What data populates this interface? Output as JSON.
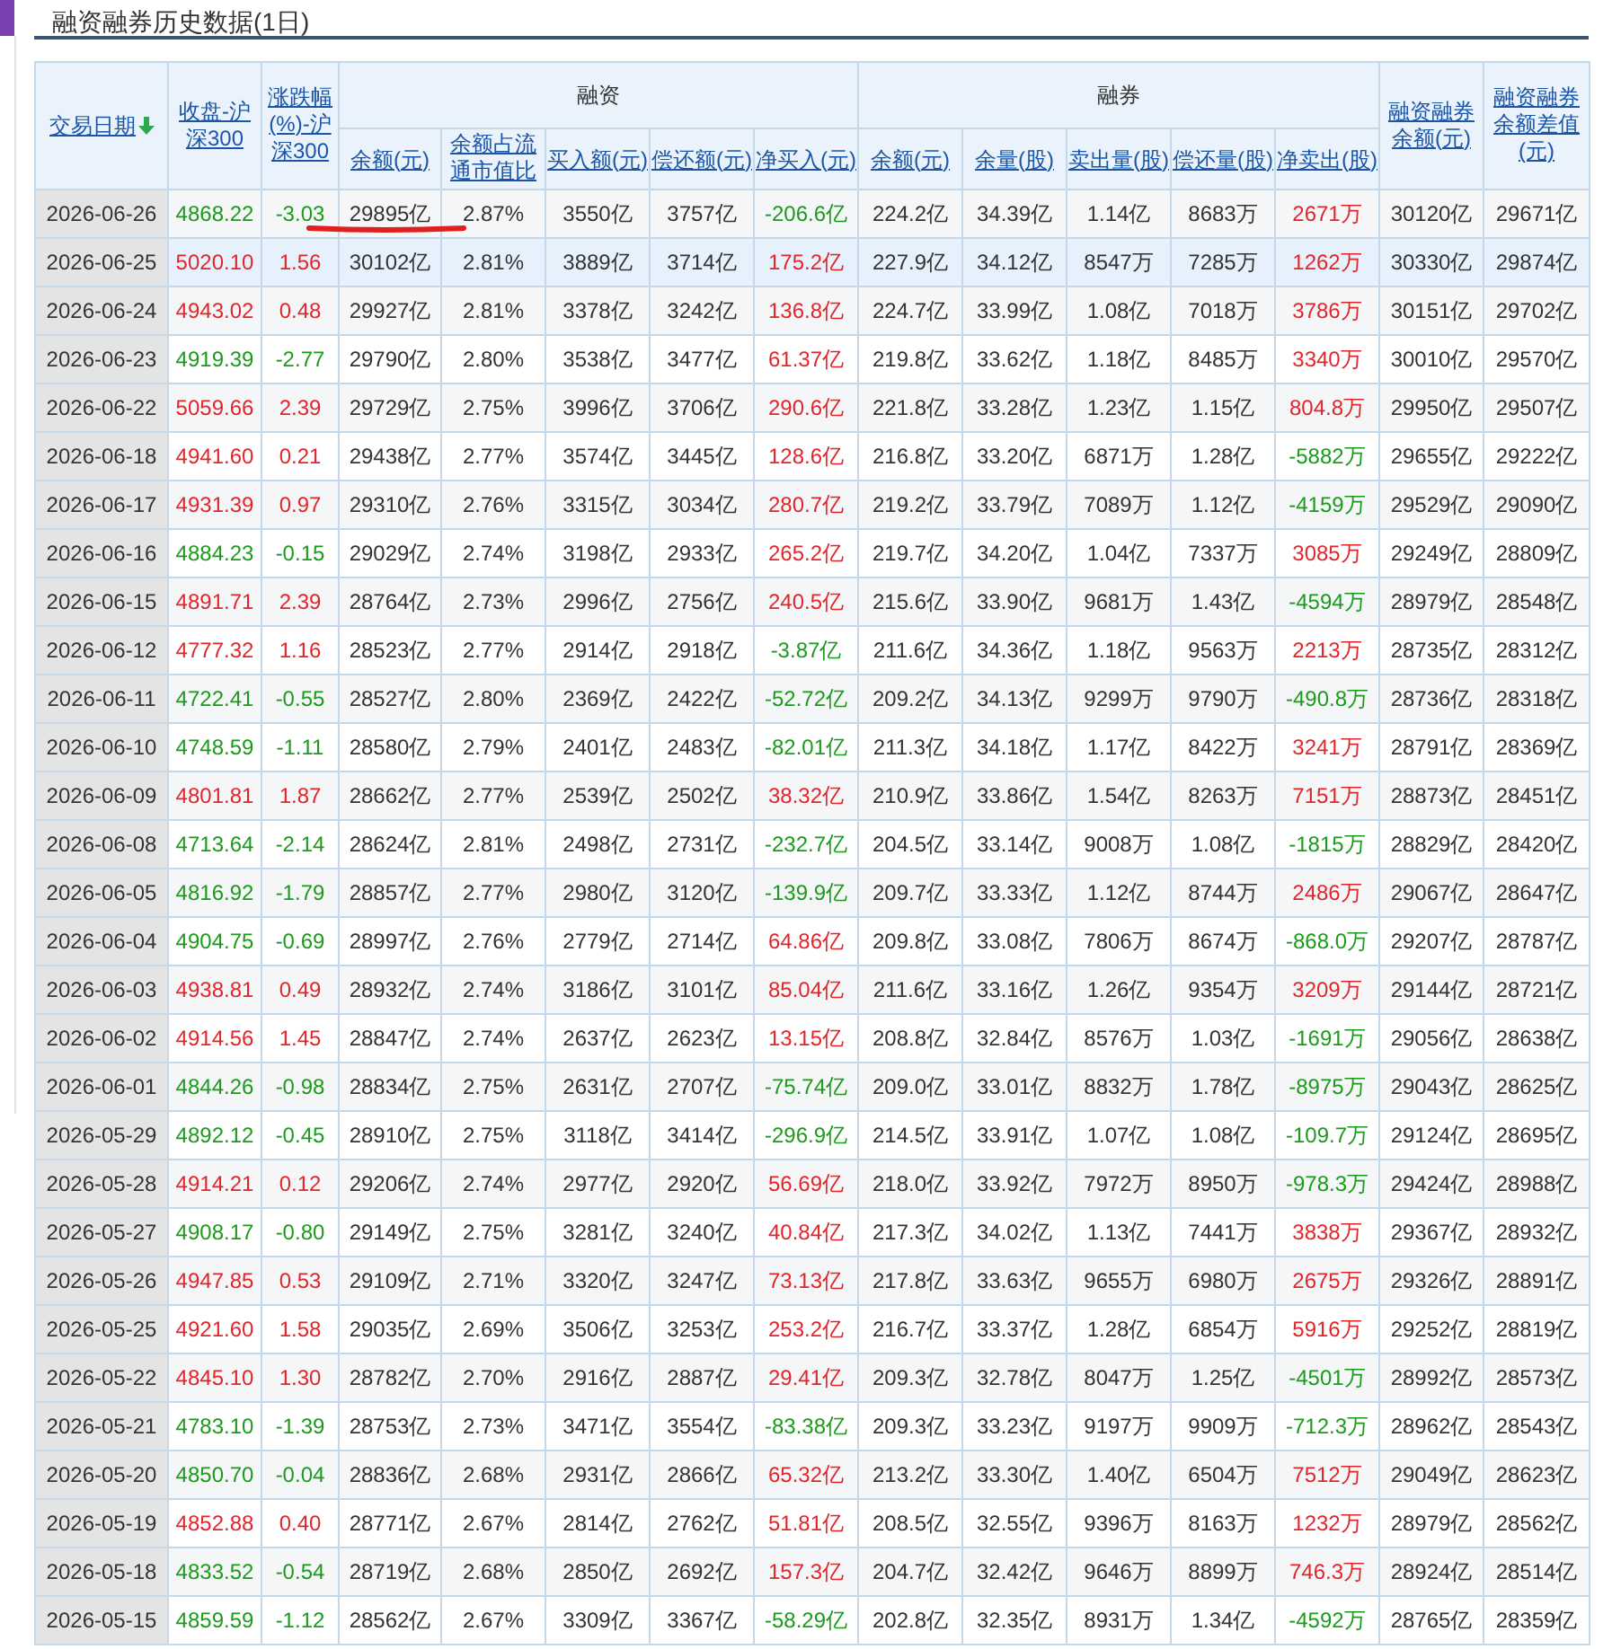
{
  "title": "融资融券历史数据(1日)",
  "columns": {
    "date": "交易日期",
    "close": "收盘-沪深300",
    "change": "涨跌幅(%)-沪深300",
    "financing": "融资",
    "securities": "融券",
    "total": "融资融券余额(元)",
    "diff": "融资融券余额差值(元)",
    "financing_sub": [
      "余额(元)",
      "余额占流通市值比",
      "买入额(元)",
      "偿还额(元)",
      "净买入(元)"
    ],
    "securities_sub": [
      "余额(元)",
      "余量(股)",
      "卖出量(股)",
      "偿还量(股)",
      "净卖出(股)"
    ]
  },
  "rows": [
    {
      "date": "2026-06-26",
      "selected": false,
      "rising": false,
      "buy_rising": false,
      "sell_rising": true,
      "cells": [
        "4868.22",
        "-3.03",
        "29895亿",
        "2.87%",
        "3550亿",
        "3757亿",
        "-206.6亿",
        "224.2亿",
        "34.39亿",
        "1.14亿",
        "8683万",
        "2671万",
        "30120亿",
        "29671亿"
      ]
    },
    {
      "date": "2026-06-25",
      "selected": true,
      "rising": true,
      "buy_rising": true,
      "sell_rising": true,
      "cells": [
        "5020.10",
        "1.56",
        "30102亿",
        "2.81%",
        "3889亿",
        "3714亿",
        "175.2亿",
        "227.9亿",
        "34.12亿",
        "8547万",
        "7285万",
        "1262万",
        "30330亿",
        "29874亿"
      ]
    },
    {
      "date": "2026-06-24",
      "selected": false,
      "rising": true,
      "buy_rising": true,
      "sell_rising": true,
      "cells": [
        "4943.02",
        "0.48",
        "29927亿",
        "2.81%",
        "3378亿",
        "3242亿",
        "136.8亿",
        "224.7亿",
        "33.99亿",
        "1.08亿",
        "7018万",
        "3786万",
        "30151亿",
        "29702亿"
      ]
    },
    {
      "date": "2026-06-23",
      "selected": false,
      "rising": false,
      "buy_rising": true,
      "sell_rising": true,
      "cells": [
        "4919.39",
        "-2.77",
        "29790亿",
        "2.80%",
        "3538亿",
        "3477亿",
        "61.37亿",
        "219.8亿",
        "33.62亿",
        "1.18亿",
        "8485万",
        "3340万",
        "30010亿",
        "29570亿"
      ]
    },
    {
      "date": "2026-06-22",
      "selected": false,
      "rising": true,
      "buy_rising": true,
      "sell_rising": true,
      "cells": [
        "5059.66",
        "2.39",
        "29729亿",
        "2.75%",
        "3996亿",
        "3706亿",
        "290.6亿",
        "221.8亿",
        "33.28亿",
        "1.23亿",
        "1.15亿",
        "804.8万",
        "29950亿",
        "29507亿"
      ]
    },
    {
      "date": "2026-06-18",
      "selected": false,
      "rising": true,
      "buy_rising": true,
      "sell_rising": false,
      "cells": [
        "4941.60",
        "0.21",
        "29438亿",
        "2.77%",
        "3574亿",
        "3445亿",
        "128.6亿",
        "216.8亿",
        "33.20亿",
        "6871万",
        "1.28亿",
        "-5882万",
        "29655亿",
        "29222亿"
      ]
    },
    {
      "date": "2026-06-17",
      "selected": false,
      "rising": true,
      "buy_rising": true,
      "sell_rising": false,
      "cells": [
        "4931.39",
        "0.97",
        "29310亿",
        "2.76%",
        "3315亿",
        "3034亿",
        "280.7亿",
        "219.2亿",
        "33.79亿",
        "7089万",
        "1.12亿",
        "-4159万",
        "29529亿",
        "29090亿"
      ]
    },
    {
      "date": "2026-06-16",
      "selected": false,
      "rising": false,
      "buy_rising": true,
      "sell_rising": true,
      "cells": [
        "4884.23",
        "-0.15",
        "29029亿",
        "2.74%",
        "3198亿",
        "2933亿",
        "265.2亿",
        "219.7亿",
        "34.20亿",
        "1.04亿",
        "7337万",
        "3085万",
        "29249亿",
        "28809亿"
      ]
    },
    {
      "date": "2026-06-15",
      "selected": false,
      "rising": true,
      "buy_rising": true,
      "sell_rising": false,
      "cells": [
        "4891.71",
        "2.39",
        "28764亿",
        "2.73%",
        "2996亿",
        "2756亿",
        "240.5亿",
        "215.6亿",
        "33.90亿",
        "9681万",
        "1.43亿",
        "-4594万",
        "28979亿",
        "28548亿"
      ]
    },
    {
      "date": "2026-06-12",
      "selected": false,
      "rising": true,
      "buy_rising": false,
      "sell_rising": true,
      "cells": [
        "4777.32",
        "1.16",
        "28523亿",
        "2.77%",
        "2914亿",
        "2918亿",
        "-3.87亿",
        "211.6亿",
        "34.36亿",
        "1.18亿",
        "9563万",
        "2213万",
        "28735亿",
        "28312亿"
      ]
    },
    {
      "date": "2026-06-11",
      "selected": false,
      "rising": false,
      "buy_rising": false,
      "sell_rising": false,
      "cells": [
        "4722.41",
        "-0.55",
        "28527亿",
        "2.80%",
        "2369亿",
        "2422亿",
        "-52.72亿",
        "209.2亿",
        "34.13亿",
        "9299万",
        "9790万",
        "-490.8万",
        "28736亿",
        "28318亿"
      ]
    },
    {
      "date": "2026-06-10",
      "selected": false,
      "rising": false,
      "buy_rising": false,
      "sell_rising": true,
      "cells": [
        "4748.59",
        "-1.11",
        "28580亿",
        "2.79%",
        "2401亿",
        "2483亿",
        "-82.01亿",
        "211.3亿",
        "34.18亿",
        "1.17亿",
        "8422万",
        "3241万",
        "28791亿",
        "28369亿"
      ]
    },
    {
      "date": "2026-06-09",
      "selected": false,
      "rising": true,
      "buy_rising": true,
      "sell_rising": true,
      "cells": [
        "4801.81",
        "1.87",
        "28662亿",
        "2.77%",
        "2539亿",
        "2502亿",
        "38.32亿",
        "210.9亿",
        "33.86亿",
        "1.54亿",
        "8263万",
        "7151万",
        "28873亿",
        "28451亿"
      ]
    },
    {
      "date": "2026-06-08",
      "selected": false,
      "rising": false,
      "buy_rising": false,
      "sell_rising": false,
      "cells": [
        "4713.64",
        "-2.14",
        "28624亿",
        "2.81%",
        "2498亿",
        "2731亿",
        "-232.7亿",
        "204.5亿",
        "33.14亿",
        "9008万",
        "1.08亿",
        "-1815万",
        "28829亿",
        "28420亿"
      ]
    },
    {
      "date": "2026-06-05",
      "selected": false,
      "rising": false,
      "buy_rising": false,
      "sell_rising": true,
      "cells": [
        "4816.92",
        "-1.79",
        "28857亿",
        "2.77%",
        "2980亿",
        "3120亿",
        "-139.9亿",
        "209.7亿",
        "33.33亿",
        "1.12亿",
        "8744万",
        "2486万",
        "29067亿",
        "28647亿"
      ]
    },
    {
      "date": "2026-06-04",
      "selected": false,
      "rising": false,
      "buy_rising": true,
      "sell_rising": false,
      "cells": [
        "4904.75",
        "-0.69",
        "28997亿",
        "2.76%",
        "2779亿",
        "2714亿",
        "64.86亿",
        "209.8亿",
        "33.08亿",
        "7806万",
        "8674万",
        "-868.0万",
        "29207亿",
        "28787亿"
      ]
    },
    {
      "date": "2026-06-03",
      "selected": false,
      "rising": true,
      "buy_rising": true,
      "sell_rising": true,
      "cells": [
        "4938.81",
        "0.49",
        "28932亿",
        "2.74%",
        "3186亿",
        "3101亿",
        "85.04亿",
        "211.6亿",
        "33.16亿",
        "1.26亿",
        "9354万",
        "3209万",
        "29144亿",
        "28721亿"
      ]
    },
    {
      "date": "2026-06-02",
      "selected": false,
      "rising": true,
      "buy_rising": true,
      "sell_rising": false,
      "cells": [
        "4914.56",
        "1.45",
        "28847亿",
        "2.74%",
        "2637亿",
        "2623亿",
        "13.15亿",
        "208.8亿",
        "32.84亿",
        "8576万",
        "1.03亿",
        "-1691万",
        "29056亿",
        "28638亿"
      ]
    },
    {
      "date": "2026-06-01",
      "selected": false,
      "rising": false,
      "buy_rising": false,
      "sell_rising": false,
      "cells": [
        "4844.26",
        "-0.98",
        "28834亿",
        "2.75%",
        "2631亿",
        "2707亿",
        "-75.74亿",
        "209.0亿",
        "33.01亿",
        "8832万",
        "1.78亿",
        "-8975万",
        "29043亿",
        "28625亿"
      ]
    },
    {
      "date": "2026-05-29",
      "selected": false,
      "rising": false,
      "buy_rising": false,
      "sell_rising": false,
      "cells": [
        "4892.12",
        "-0.45",
        "28910亿",
        "2.75%",
        "3118亿",
        "3414亿",
        "-296.9亿",
        "214.5亿",
        "33.91亿",
        "1.07亿",
        "1.08亿",
        "-109.7万",
        "29124亿",
        "28695亿"
      ]
    },
    {
      "date": "2026-05-28",
      "selected": false,
      "rising": true,
      "buy_rising": true,
      "sell_rising": false,
      "cells": [
        "4914.21",
        "0.12",
        "29206亿",
        "2.74%",
        "2977亿",
        "2920亿",
        "56.69亿",
        "218.0亿",
        "33.92亿",
        "7972万",
        "8950万",
        "-978.3万",
        "29424亿",
        "28988亿"
      ]
    },
    {
      "date": "2026-05-27",
      "selected": false,
      "rising": false,
      "buy_rising": true,
      "sell_rising": true,
      "cells": [
        "4908.17",
        "-0.80",
        "29149亿",
        "2.75%",
        "3281亿",
        "3240亿",
        "40.84亿",
        "217.3亿",
        "34.02亿",
        "1.13亿",
        "7441万",
        "3838万",
        "29367亿",
        "28932亿"
      ]
    },
    {
      "date": "2026-05-26",
      "selected": false,
      "rising": true,
      "buy_rising": true,
      "sell_rising": true,
      "cells": [
        "4947.85",
        "0.53",
        "29109亿",
        "2.71%",
        "3320亿",
        "3247亿",
        "73.13亿",
        "217.8亿",
        "33.63亿",
        "9655万",
        "6980万",
        "2675万",
        "29326亿",
        "28891亿"
      ]
    },
    {
      "date": "2026-05-25",
      "selected": false,
      "rising": true,
      "buy_rising": true,
      "sell_rising": true,
      "cells": [
        "4921.60",
        "1.58",
        "29035亿",
        "2.69%",
        "3506亿",
        "3253亿",
        "253.2亿",
        "216.7亿",
        "33.37亿",
        "1.28亿",
        "6854万",
        "5916万",
        "29252亿",
        "28819亿"
      ]
    },
    {
      "date": "2026-05-22",
      "selected": false,
      "rising": true,
      "buy_rising": true,
      "sell_rising": false,
      "cells": [
        "4845.10",
        "1.30",
        "28782亿",
        "2.70%",
        "2916亿",
        "2887亿",
        "29.41亿",
        "209.3亿",
        "32.78亿",
        "8047万",
        "1.25亿",
        "-4501万",
        "28992亿",
        "28573亿"
      ]
    },
    {
      "date": "2026-05-21",
      "selected": false,
      "rising": false,
      "buy_rising": false,
      "sell_rising": false,
      "cells": [
        "4783.10",
        "-1.39",
        "28753亿",
        "2.73%",
        "3471亿",
        "3554亿",
        "-83.38亿",
        "209.3亿",
        "33.23亿",
        "9197万",
        "9909万",
        "-712.3万",
        "28962亿",
        "28543亿"
      ]
    },
    {
      "date": "2026-05-20",
      "selected": false,
      "rising": false,
      "buy_rising": true,
      "sell_rising": true,
      "cells": [
        "4850.70",
        "-0.04",
        "28836亿",
        "2.68%",
        "2931亿",
        "2866亿",
        "65.32亿",
        "213.2亿",
        "33.30亿",
        "1.40亿",
        "6504万",
        "7512万",
        "29049亿",
        "28623亿"
      ]
    },
    {
      "date": "2026-05-19",
      "selected": false,
      "rising": true,
      "buy_rising": true,
      "sell_rising": true,
      "cells": [
        "4852.88",
        "0.40",
        "28771亿",
        "2.67%",
        "2814亿",
        "2762亿",
        "51.81亿",
        "208.5亿",
        "32.55亿",
        "9396万",
        "8163万",
        "1232万",
        "28979亿",
        "28562亿"
      ]
    },
    {
      "date": "2026-05-18",
      "selected": false,
      "rising": false,
      "buy_rising": true,
      "sell_rising": true,
      "cells": [
        "4833.52",
        "-0.54",
        "28719亿",
        "2.68%",
        "2850亿",
        "2692亿",
        "157.3亿",
        "204.7亿",
        "32.42亿",
        "9646万",
        "8899万",
        "746.3万",
        "28924亿",
        "28514亿"
      ]
    },
    {
      "date": "2026-05-15",
      "selected": false,
      "rising": false,
      "buy_rising": false,
      "sell_rising": false,
      "cells": [
        "4859.59",
        "-1.12",
        "28562亿",
        "2.67%",
        "3309亿",
        "3367亿",
        "-58.29亿",
        "202.8亿",
        "32.35亿",
        "8931万",
        "1.34亿",
        "-4592万",
        "28765亿",
        "28359亿"
      ]
    }
  ]
}
